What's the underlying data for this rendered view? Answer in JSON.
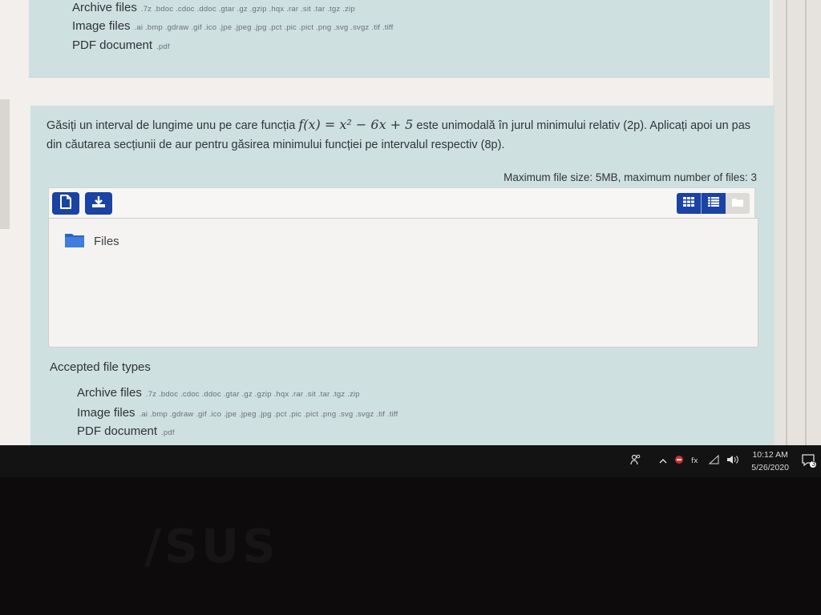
{
  "top_card": {
    "file_types": [
      {
        "label": "Archive files",
        "extensions": ".7z .bdoc .cdoc .ddoc .gtar .gz .gzip .hqx .rar .sit .tar .tgz .zip"
      },
      {
        "label": "Image files",
        "extensions": ".ai .bmp .gdraw .gif .ico .jpe .jpeg .jpg .pct .pic .pict .png .svg .svgz .tif .tiff"
      },
      {
        "label": "PDF document",
        "extensions": ".pdf"
      }
    ]
  },
  "question": {
    "text_before": "Găsiți un interval de lungime unu pe care funcția",
    "formula": "f(x) = x² − 6x + 5",
    "text_after": "este unimodală în jurul minimului relativ (2p). Aplicați apoi un pas din căutarea secțiunii de aur pentru găsirea minimului funcției pe intervalul respectiv (8p)."
  },
  "upload": {
    "max_info": "Maximum file size: 5MB, maximum number of files: 3",
    "toolbar": {
      "add_file_icon": "file-add-icon",
      "download_icon": "download-icon",
      "views": [
        "grid-view-icon",
        "list-view-icon",
        "folder-view-icon"
      ]
    },
    "folder_label": "Files"
  },
  "accepted": {
    "title": "Accepted file types",
    "file_types": [
      {
        "label": "Archive files",
        "extensions": ".7z .bdoc .cdoc .ddoc .gtar .gz .gzip .hqx .rar .sit .tar .tgz .zip"
      },
      {
        "label": "Image files",
        "extensions": ".ai .bmp .gdraw .gif .ico .jpe .jpeg .jpg .pct .pic .pict .png .svg .svgz .tif .tiff"
      },
      {
        "label": "PDF document",
        "extensions": ".pdf"
      }
    ]
  },
  "taskbar": {
    "time": "10:12 AM",
    "date": "5/26/2020",
    "notification_count": "3"
  },
  "colors": {
    "card_bg": "#cfe0e1",
    "button_blue": "#1a43a4"
  }
}
